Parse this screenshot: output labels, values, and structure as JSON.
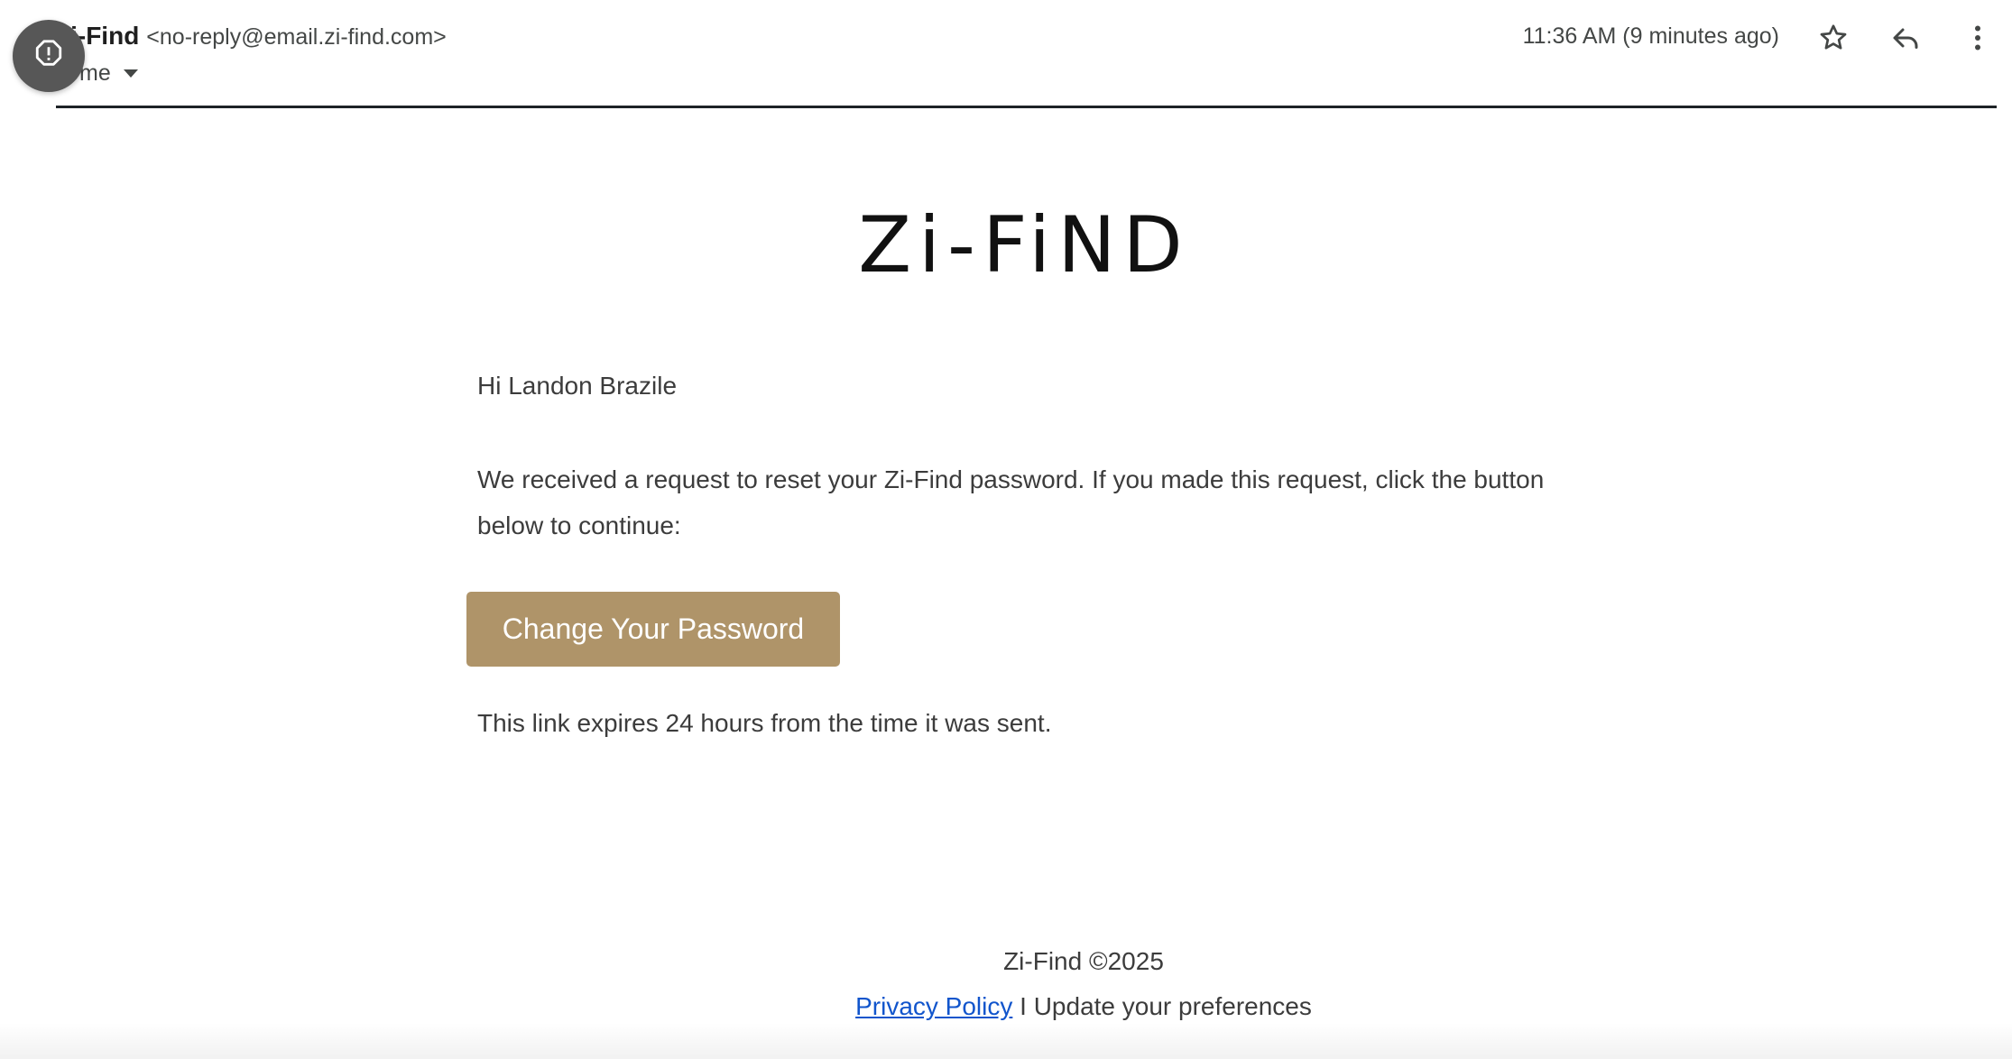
{
  "header": {
    "sender_name": "Zi-Find",
    "sender_email": "<no-reply@email.zi-find.com>",
    "recipient": "me",
    "timestamp": "11:36 AM (9 minutes ago)",
    "icons": [
      "alert-icon",
      "star-icon",
      "reply-icon",
      "more-vert-icon"
    ]
  },
  "email": {
    "logo_text": "Zi-FiND",
    "greeting": "Hi Landon Brazile",
    "body": "We received a request to reset your Zi-Find password. If you made this request, click the button below to continue:",
    "button_label": "Change Your Password",
    "expiry_note": "This link expires 24 hours from the time it was sent."
  },
  "footer": {
    "copyright": "Zi-Find ©2025",
    "privacy_label": "Privacy Policy",
    "separator": "I",
    "preferences_label": "Update your preferences"
  },
  "colors": {
    "button_bg": "#af9469",
    "link": "#1155cc",
    "badge": "#575757",
    "rule": "#1d2326"
  }
}
